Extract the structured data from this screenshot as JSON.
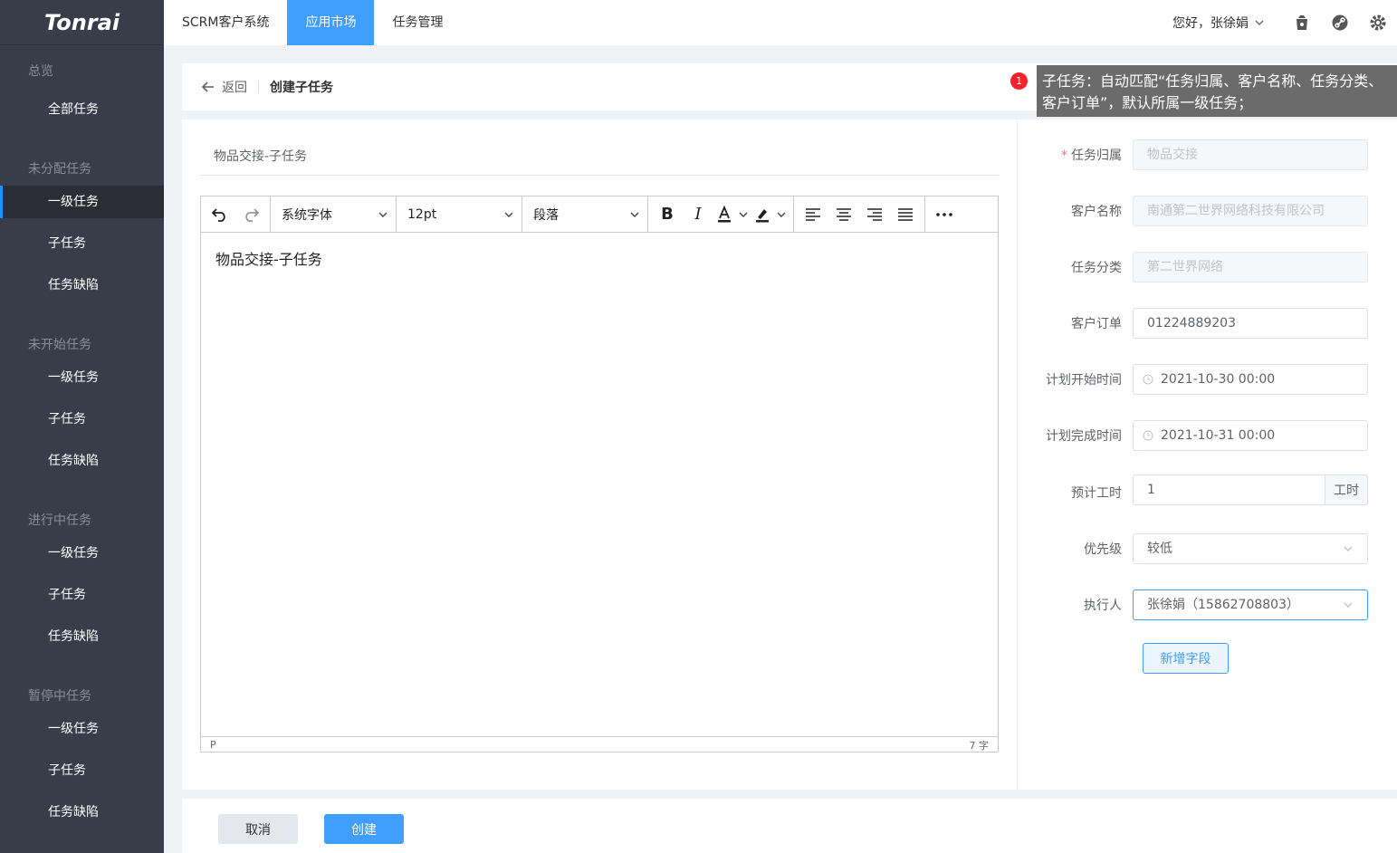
{
  "sidebar": {
    "logo": "Tonrai",
    "overview": "总览",
    "all_tasks": "全部任务",
    "groups": [
      {
        "title": "未分配任务",
        "items": [
          "一级任务",
          "子任务",
          "任务缺陷"
        ]
      },
      {
        "title": "未开始任务",
        "items": [
          "一级任务",
          "子任务",
          "任务缺陷"
        ]
      },
      {
        "title": "进行中任务",
        "items": [
          "一级任务",
          "子任务",
          "任务缺陷"
        ]
      },
      {
        "title": "暂停中任务",
        "items": [
          "一级任务",
          "子任务",
          "任务缺陷"
        ]
      }
    ]
  },
  "topbar": {
    "tabs": [
      "SCRM客户系统",
      "应用市场",
      "任务管理"
    ],
    "active_tab": 1,
    "greeting": "您好，张徐娟"
  },
  "crumb": {
    "back": "返回",
    "title": "创建子任务"
  },
  "tooltip": {
    "badge": "1",
    "text": "子任务：自动匹配“任务归属、客户名称、任务分类、客户订单”，默认所属一级任务；"
  },
  "editor": {
    "title_value": "物品交接-子任务",
    "font_family": "系统字体",
    "font_size": "12pt",
    "block": "段落",
    "content": "物品交接-子任务",
    "status_path": "P",
    "word_count": "7 字"
  },
  "form": {
    "owner_label": "任务归属",
    "owner_value": "物品交接",
    "customer_label": "客户名称",
    "customer_value": "南通第二世界网络科技有限公司",
    "category_label": "任务分类",
    "category_value": "第二世界网络",
    "order_label": "客户订单",
    "order_value": "01224889203",
    "start_label": "计划开始时间",
    "start_value": "2021-10-30 00:00",
    "end_label": "计划完成时间",
    "end_value": "2021-10-31 00:00",
    "hours_label": "预计工时",
    "hours_value": "1",
    "hours_unit": "工时",
    "priority_label": "优先级",
    "priority_value": "较低",
    "assignee_label": "执行人",
    "assignee_value": "张徐娟（15862708803）",
    "add_field": "新增字段"
  },
  "footer": {
    "cancel": "取消",
    "create": "创建"
  },
  "colors": {
    "primary": "#409eff",
    "sidebar": "#393d49",
    "badge": "#f5222d"
  }
}
